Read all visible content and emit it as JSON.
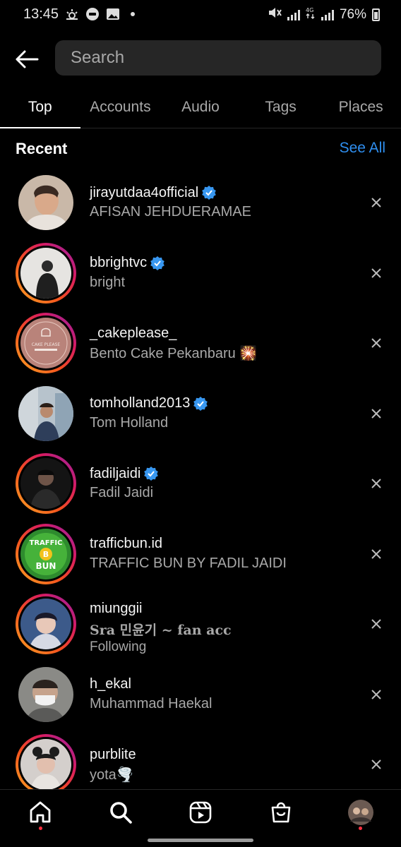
{
  "status": {
    "time": "13:45",
    "battery": "76%"
  },
  "search": {
    "placeholder": "Search"
  },
  "tabs": [
    {
      "label": "Top",
      "active": true
    },
    {
      "label": "Accounts"
    },
    {
      "label": "Audio"
    },
    {
      "label": "Tags"
    },
    {
      "label": "Places"
    }
  ],
  "recent": {
    "title": "Recent",
    "see_all": "See All"
  },
  "items": [
    {
      "username": "jirayutdaa4official",
      "verified": true,
      "subtitle": "AFISAN JEHDUERAMAE",
      "ring": false
    },
    {
      "username": "bbrightvc",
      "verified": true,
      "subtitle": "bright",
      "ring": true
    },
    {
      "username": "_cakeplease_",
      "verified": false,
      "subtitle": "Bento Cake Pekanbaru 🎇",
      "ring": true
    },
    {
      "username": "tomholland2013",
      "verified": true,
      "subtitle": "Tom Holland",
      "ring": false
    },
    {
      "username": "fadiljaidi",
      "verified": true,
      "subtitle": "Fadil Jaidi",
      "ring": true
    },
    {
      "username": "trafficbun.id",
      "verified": false,
      "subtitle": "TRAFFIC BUN BY FADIL JAIDI",
      "ring": true
    },
    {
      "username": "miunggii",
      "verified": false,
      "subtitle": "𝐒𝐫𝐚 민윤기 ~ 𝐟𝐚𝐧 𝐚𝐜𝐜",
      "extra": "Following",
      "ring": true
    },
    {
      "username": "h_ekal",
      "verified": false,
      "subtitle": "Muhammad Haekal",
      "ring": false
    },
    {
      "username": "purblite",
      "verified": false,
      "subtitle": "yota🌪️",
      "ring": true
    }
  ],
  "avatar_logo": {
    "cake": "CAKE PLEASE",
    "traffic_top": "TRAFFIC",
    "traffic_bottom": "BUN"
  },
  "colors": {
    "accent": "#2f8ff0",
    "verified": "#3897f0",
    "notification": "#ff3040"
  },
  "nav": [
    "home-icon",
    "search-icon",
    "reels-icon",
    "shop-icon",
    "profile-avatar"
  ]
}
